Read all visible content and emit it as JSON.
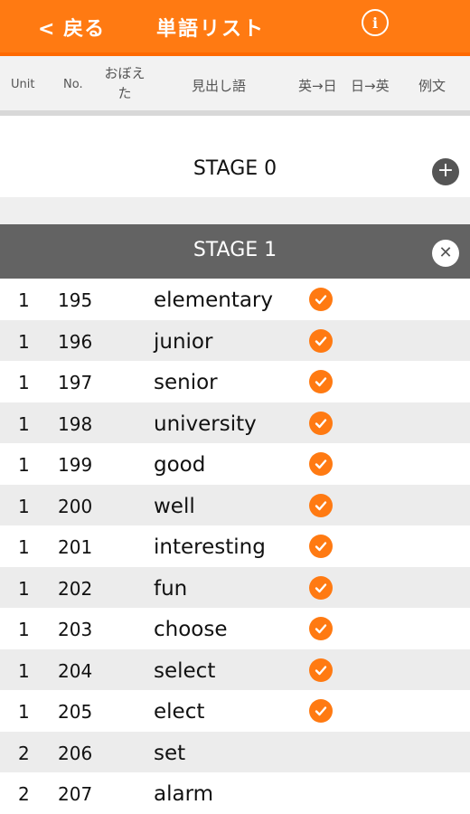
{
  "header": {
    "back_label": "< 戻る",
    "title": "単語リスト",
    "info_icon": "info-icon",
    "accent": "#FF7A12"
  },
  "columns": {
    "unit": "Unit",
    "no": "No.",
    "learned_line1": "おぼえ",
    "learned_line2": "た",
    "headword": "見出し語",
    "en_ja": "英→日",
    "ja_en": "日→英",
    "example": "例文"
  },
  "stages": [
    {
      "label": "STAGE 0",
      "expanded": false
    },
    {
      "label": "STAGE 1",
      "expanded": true
    }
  ],
  "words": [
    {
      "unit": "1",
      "no": "195",
      "word": "elementary",
      "learned": true
    },
    {
      "unit": "1",
      "no": "196",
      "word": "junior",
      "learned": true
    },
    {
      "unit": "1",
      "no": "197",
      "word": "senior",
      "learned": true
    },
    {
      "unit": "1",
      "no": "198",
      "word": "university",
      "learned": true
    },
    {
      "unit": "1",
      "no": "199",
      "word": "good",
      "learned": true
    },
    {
      "unit": "1",
      "no": "200",
      "word": "well",
      "learned": true
    },
    {
      "unit": "1",
      "no": "201",
      "word": "interesting",
      "learned": true
    },
    {
      "unit": "1",
      "no": "202",
      "word": "fun",
      "learned": true
    },
    {
      "unit": "1",
      "no": "203",
      "word": "choose",
      "learned": true
    },
    {
      "unit": "1",
      "no": "204",
      "word": "select",
      "learned": true
    },
    {
      "unit": "1",
      "no": "205",
      "word": "elect",
      "learned": true
    },
    {
      "unit": "2",
      "no": "206",
      "word": "set",
      "learned": false
    },
    {
      "unit": "2",
      "no": "207",
      "word": "alarm",
      "learned": false
    }
  ]
}
